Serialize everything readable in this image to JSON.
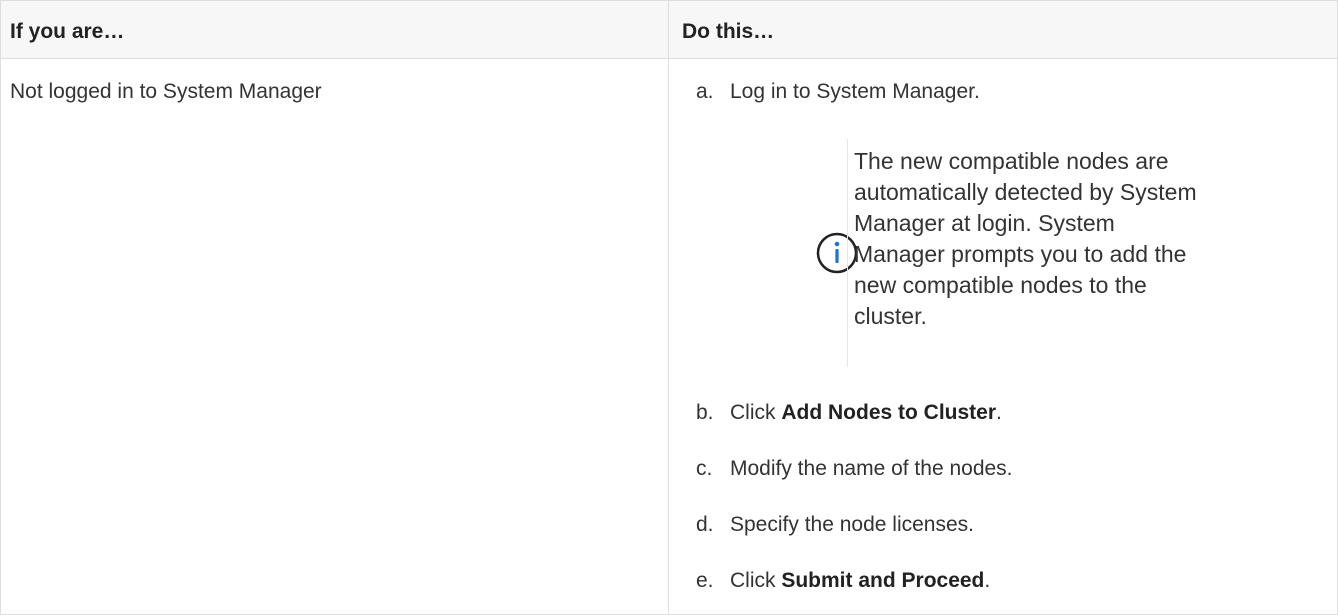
{
  "table": {
    "headers": {
      "left": "If you are…",
      "right": "Do this…"
    },
    "rows": [
      {
        "condition": "Not logged in to System Manager",
        "steps": [
          {
            "marker": "a.",
            "text": "Log in to System Manager."
          },
          {
            "marker": "b.",
            "prefix": "Click ",
            "bold": "Add Nodes to Cluster",
            "suffix": "."
          },
          {
            "marker": "c.",
            "text": "Modify the name of the nodes."
          },
          {
            "marker": "d.",
            "text": "Specify the node licenses."
          },
          {
            "marker": "e.",
            "prefix": "Click ",
            "bold": "Submit and Proceed",
            "suffix": "."
          }
        ],
        "note": {
          "icon": "info-icon",
          "text": "The new compatible nodes are\nautomatically detected by System\nManager at login. System\nManager prompts you to add the\nnew compatible nodes to the\ncluster."
        }
      }
    ]
  },
  "colors": {
    "accent": "#1a73d9",
    "border": "#dedede",
    "header_bg": "#f7f7f8",
    "text": "#333333"
  }
}
